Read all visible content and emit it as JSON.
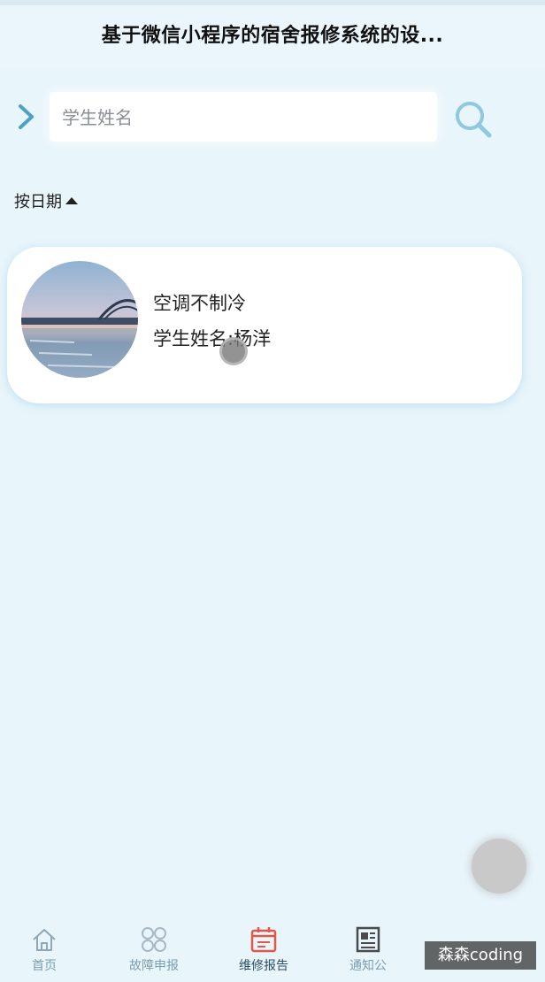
{
  "header": {
    "title": "基于微信小程序的宿舍报修系统的设..."
  },
  "search": {
    "placeholder": "学生姓名",
    "value": ""
  },
  "sort": {
    "label": "按日期"
  },
  "records": [
    {
      "title": "空调不制冷",
      "student": "学生姓名:杨洋",
      "image_icon": "bridge-sunset-photo"
    }
  ],
  "tabbar": {
    "items": [
      {
        "label": "首页",
        "icon": "home-icon",
        "active": false
      },
      {
        "label": "故障申报",
        "icon": "grid-icon",
        "active": false
      },
      {
        "label": "维修报告",
        "icon": "calendar-icon",
        "active": true
      },
      {
        "label": "通知公",
        "icon": "news-icon",
        "active": false
      }
    ]
  },
  "watermark": "森森coding",
  "colors": {
    "background": "#e8f5fb",
    "accent": "#5aa8c8",
    "active_tab_icon": "#e0584a"
  }
}
